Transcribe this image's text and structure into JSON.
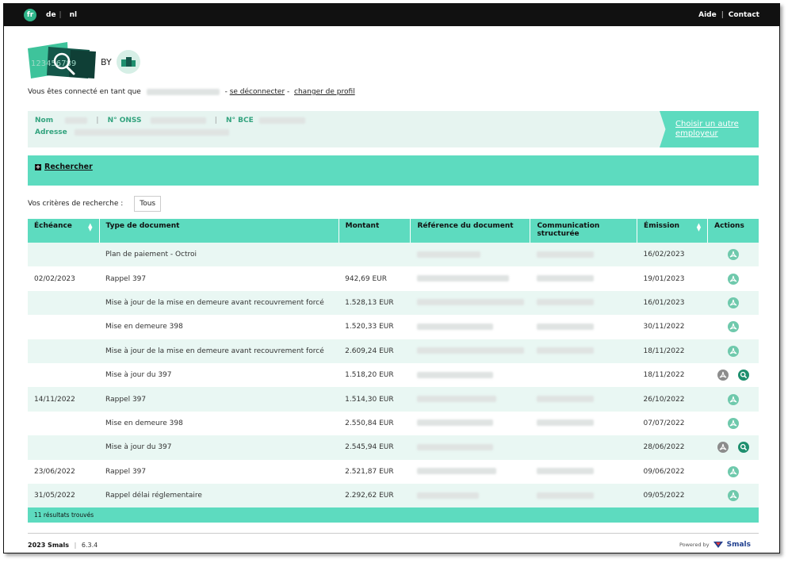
{
  "topbar": {
    "lang_active": "fr",
    "langs": [
      "de",
      "nl"
    ],
    "help": "Aide",
    "contact": "Contact"
  },
  "logo": {
    "numbers": "123456789",
    "by": "BY"
  },
  "session": {
    "prefix": "Vous êtes connecté en tant que",
    "logout": "se déconnecter",
    "change_profile": "changer de profil"
  },
  "employer": {
    "nom_label": "Nom",
    "onss_label": "N° ONSS",
    "bce_label": "N° BCE",
    "adresse_label": "Adresse",
    "choose_other": "Choisir un autre employeur"
  },
  "search": {
    "toggle_label": "Rechercher",
    "criteria_label": "Vos critères de recherche :",
    "criteria_value": "Tous"
  },
  "table": {
    "headers": [
      "Échéance",
      "Type de document",
      "Montant",
      "Référence du document",
      "Communication structurée",
      "Émission",
      "Actions"
    ],
    "rows": [
      {
        "echeance": "",
        "type": "Plan de paiement - Octroi",
        "montant": "",
        "emission": "16/02/2023",
        "zoom": false
      },
      {
        "echeance": "02/02/2023",
        "type": "Rappel 397",
        "montant": "942,69 EUR",
        "emission": "19/01/2023",
        "zoom": false
      },
      {
        "echeance": "",
        "type": "Mise à jour de la mise en demeure avant recouvrement forcé",
        "montant": "1.528,13 EUR",
        "emission": "16/01/2023",
        "zoom": false
      },
      {
        "echeance": "",
        "type": "Mise en demeure 398",
        "montant": "1.520,33 EUR",
        "emission": "30/11/2022",
        "zoom": false
      },
      {
        "echeance": "",
        "type": "Mise à jour de la mise en demeure avant recouvrement forcé",
        "montant": "2.609,24 EUR",
        "emission": "18/11/2022",
        "zoom": false
      },
      {
        "echeance": "",
        "type": "Mise à jour du 397",
        "montant": "1.518,20 EUR",
        "emission": "18/11/2022",
        "zoom": true
      },
      {
        "echeance": "14/11/2022",
        "type": "Rappel 397",
        "montant": "1.514,30 EUR",
        "emission": "26/10/2022",
        "zoom": false
      },
      {
        "echeance": "",
        "type": "Mise en demeure 398",
        "montant": "2.550,84 EUR",
        "emission": "07/07/2022",
        "zoom": false
      },
      {
        "echeance": "",
        "type": "Mise à jour du 397",
        "montant": "2.545,94 EUR",
        "emission": "28/06/2022",
        "zoom": true
      },
      {
        "echeance": "23/06/2022",
        "type": "Rappel 397",
        "montant": "2.521,87 EUR",
        "emission": "09/06/2022",
        "zoom": false
      },
      {
        "echeance": "31/05/2022",
        "type": "Rappel délai réglementaire",
        "montant": "2.292,62 EUR",
        "emission": "09/05/2022",
        "zoom": false
      }
    ],
    "results": "11 résultats trouvés"
  },
  "footer": {
    "year_brand": "2023 Smals",
    "version": "6.3.4",
    "powered_by": "Powered by",
    "brand": "Smals"
  },
  "colors": {
    "accent": "#5ddbbf",
    "accent_dark": "#33a37e",
    "row_alt": "#e9f7f3"
  }
}
